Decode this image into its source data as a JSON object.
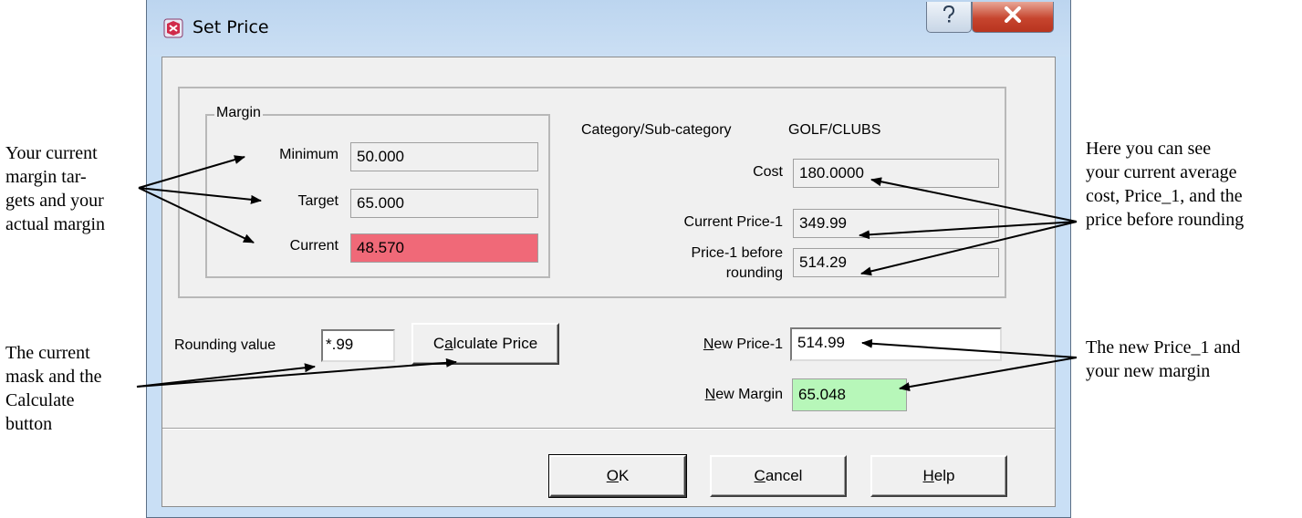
{
  "window": {
    "title": "Set Price"
  },
  "margin": {
    "group_label": "Margin",
    "minimum_label": "Minimum",
    "minimum_value": "50.000",
    "target_label": "Target",
    "target_value": "65.000",
    "current_label": "Current",
    "current_value": "48.570",
    "current_color": "#f06978"
  },
  "category": {
    "label": "Category/Sub-category",
    "value": "GOLF/CLUBS"
  },
  "cost": {
    "label": "Cost",
    "value": "180.0000"
  },
  "current_price": {
    "label": "Current Price-1",
    "value": "349.99"
  },
  "price_before_rounding": {
    "label_line1": "Price-1 before",
    "label_line2": "rounding",
    "value": "514.29"
  },
  "rounding": {
    "label": "Rounding value",
    "value": "*.99"
  },
  "calculate_button": {
    "prefix": "C",
    "mnemonic": "a",
    "rest": "lculate Price"
  },
  "new_price": {
    "mnemonic": "N",
    "rest": "ew Price-1",
    "value": "514.99"
  },
  "new_margin": {
    "mnemonic": "N",
    "rest": "ew Margin",
    "value": "65.048",
    "color": "#b7f7b9"
  },
  "footer": {
    "ok": {
      "mnemonic": "O",
      "rest": "K"
    },
    "cancel": {
      "mnemonic": "C",
      "rest": "ancel"
    },
    "help": {
      "mnemonic": "H",
      "rest": "elp"
    }
  },
  "titlebar_icons": [
    "app-icon",
    "help-icon",
    "close-icon"
  ],
  "annotations": {
    "left_top": [
      "Your current",
      "margin tar-",
      "gets and your",
      "actual margin"
    ],
    "left_bottom": [
      "The current",
      "mask and the",
      "Calculate",
      "button"
    ],
    "right_top": [
      "Here you can see",
      "your current average",
      "cost, Price_1, and the",
      "price before rounding"
    ],
    "right_bottom": [
      "The new Price_1 and",
      "your new margin"
    ]
  }
}
